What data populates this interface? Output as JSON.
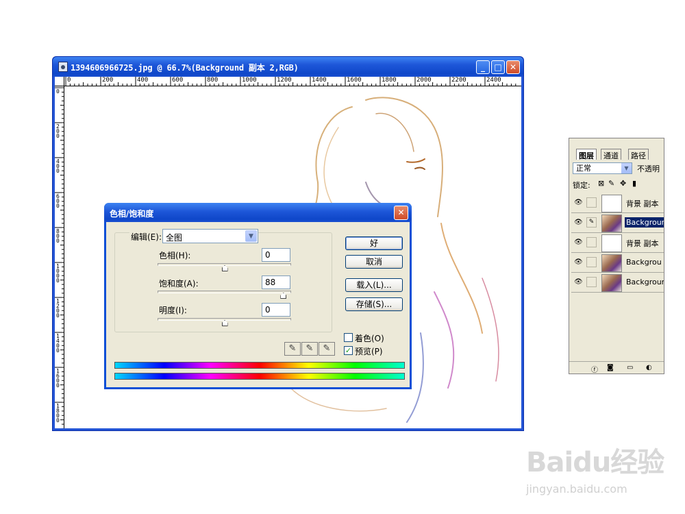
{
  "document": {
    "title": "1394606966725.jpg @ 66.7%(Background 副本 2,RGB)",
    "minimize_glyph": "_",
    "maximize_glyph": "□",
    "close_glyph": "✕",
    "ruler_h": [
      "0",
      "200",
      "400",
      "600",
      "800",
      "1000",
      "1200",
      "1400",
      "1600",
      "1800",
      "2000",
      "2200",
      "2400"
    ],
    "ruler_v": [
      "0",
      "2 0 0",
      "4 0 0",
      "6 0 0",
      "8 0 0",
      "1 0 0 0",
      "1 2 0 0",
      "1 4 0 0",
      "1 6 0 0",
      "1 8 0 0"
    ]
  },
  "dialog": {
    "title": "色相/饱和度",
    "close_glyph": "✕",
    "edit_label": "编辑(E):",
    "edit_value": "全图",
    "hue_label": "色相(H):",
    "hue_value": "0",
    "hue_level": 0,
    "saturation_label": "饱和度(A):",
    "saturation_value": "88",
    "saturation_level": 88,
    "lightness_label": "明度(I):",
    "lightness_value": "0",
    "lightness_level": 0,
    "ok_label": "好",
    "cancel_label": "取消",
    "load_label": "载入(L)...",
    "save_label": "存储(S)...",
    "colorize_label": "着色(O)",
    "colorize_checked": false,
    "preview_label": "预览(P)",
    "preview_checked": true
  },
  "layers_panel": {
    "tabs": [
      "图层",
      "通道",
      "路径"
    ],
    "blend_mode": "正常",
    "opacity_label": "不透明",
    "lock_label": "锁定:",
    "layers": [
      {
        "name": "背景 副本",
        "visible": true,
        "selected": false,
        "thumb": "sketch"
      },
      {
        "name": "Backgroun",
        "visible": true,
        "selected": true,
        "thumb": "photo"
      },
      {
        "name": "背景 副本",
        "visible": true,
        "selected": false,
        "thumb": "sketch"
      },
      {
        "name": "Backgrou",
        "visible": true,
        "selected": false,
        "thumb": "photo"
      },
      {
        "name": "Backgroun",
        "visible": true,
        "selected": false,
        "thumb": "photo"
      }
    ]
  },
  "watermark": {
    "logo": "Baidu经验",
    "url": "jingyan.baidu.com"
  }
}
